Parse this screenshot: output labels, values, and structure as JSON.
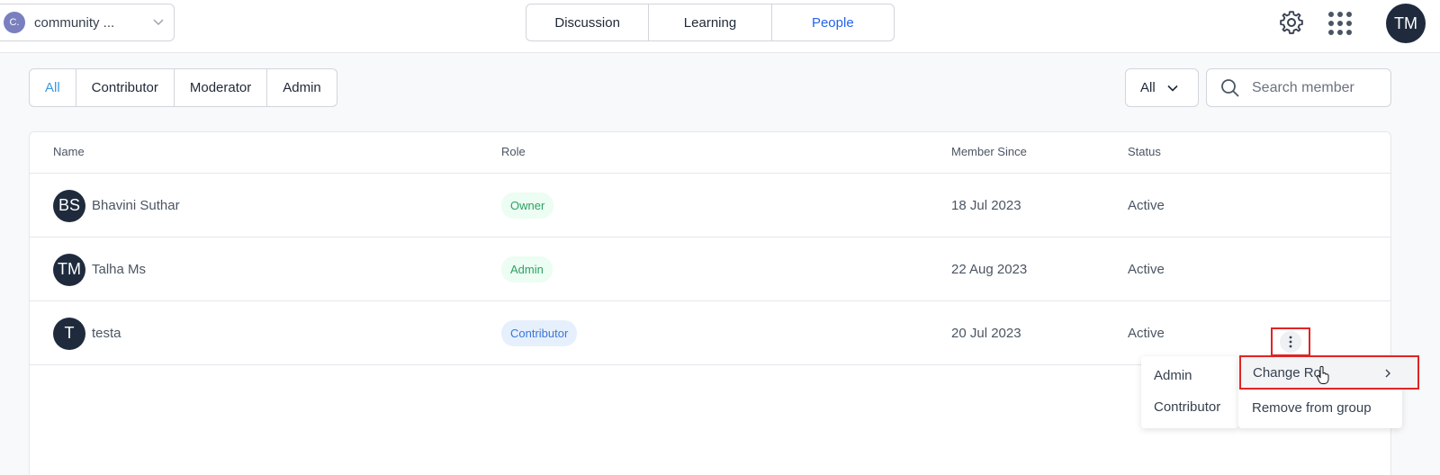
{
  "topbar": {
    "community_initial": "C.",
    "community_name": "community ...",
    "tabs": [
      "Discussion",
      "Learning",
      "People"
    ],
    "active_tab": "People",
    "user_initials": "TM"
  },
  "filters": {
    "tabs": [
      "All",
      "Contributor",
      "Moderator",
      "Admin"
    ],
    "active": "All",
    "status_value": "All",
    "search_placeholder": "Search member"
  },
  "table": {
    "headers": [
      "Name",
      "Role",
      "Member Since",
      "Status"
    ],
    "rows": [
      {
        "initials": "BS",
        "name": "Bhavini Suthar",
        "role": "Owner",
        "since": "18 Jul 2023",
        "status": "Active"
      },
      {
        "initials": "TM",
        "name": "Talha Ms",
        "role": "Admin",
        "since": "22 Aug 2023",
        "status": "Active"
      },
      {
        "initials": "T",
        "name": "testa",
        "role": "Contributor",
        "since": "20 Jul 2023",
        "status": "Active"
      }
    ]
  },
  "context_menu": {
    "submenu": [
      "Admin",
      "Contributor"
    ],
    "items": [
      "Change Ro",
      "Remove from group"
    ]
  },
  "colors": {
    "accent": "#2563eb",
    "highlight": "#e02424",
    "avatar": "#1f2b3d"
  }
}
